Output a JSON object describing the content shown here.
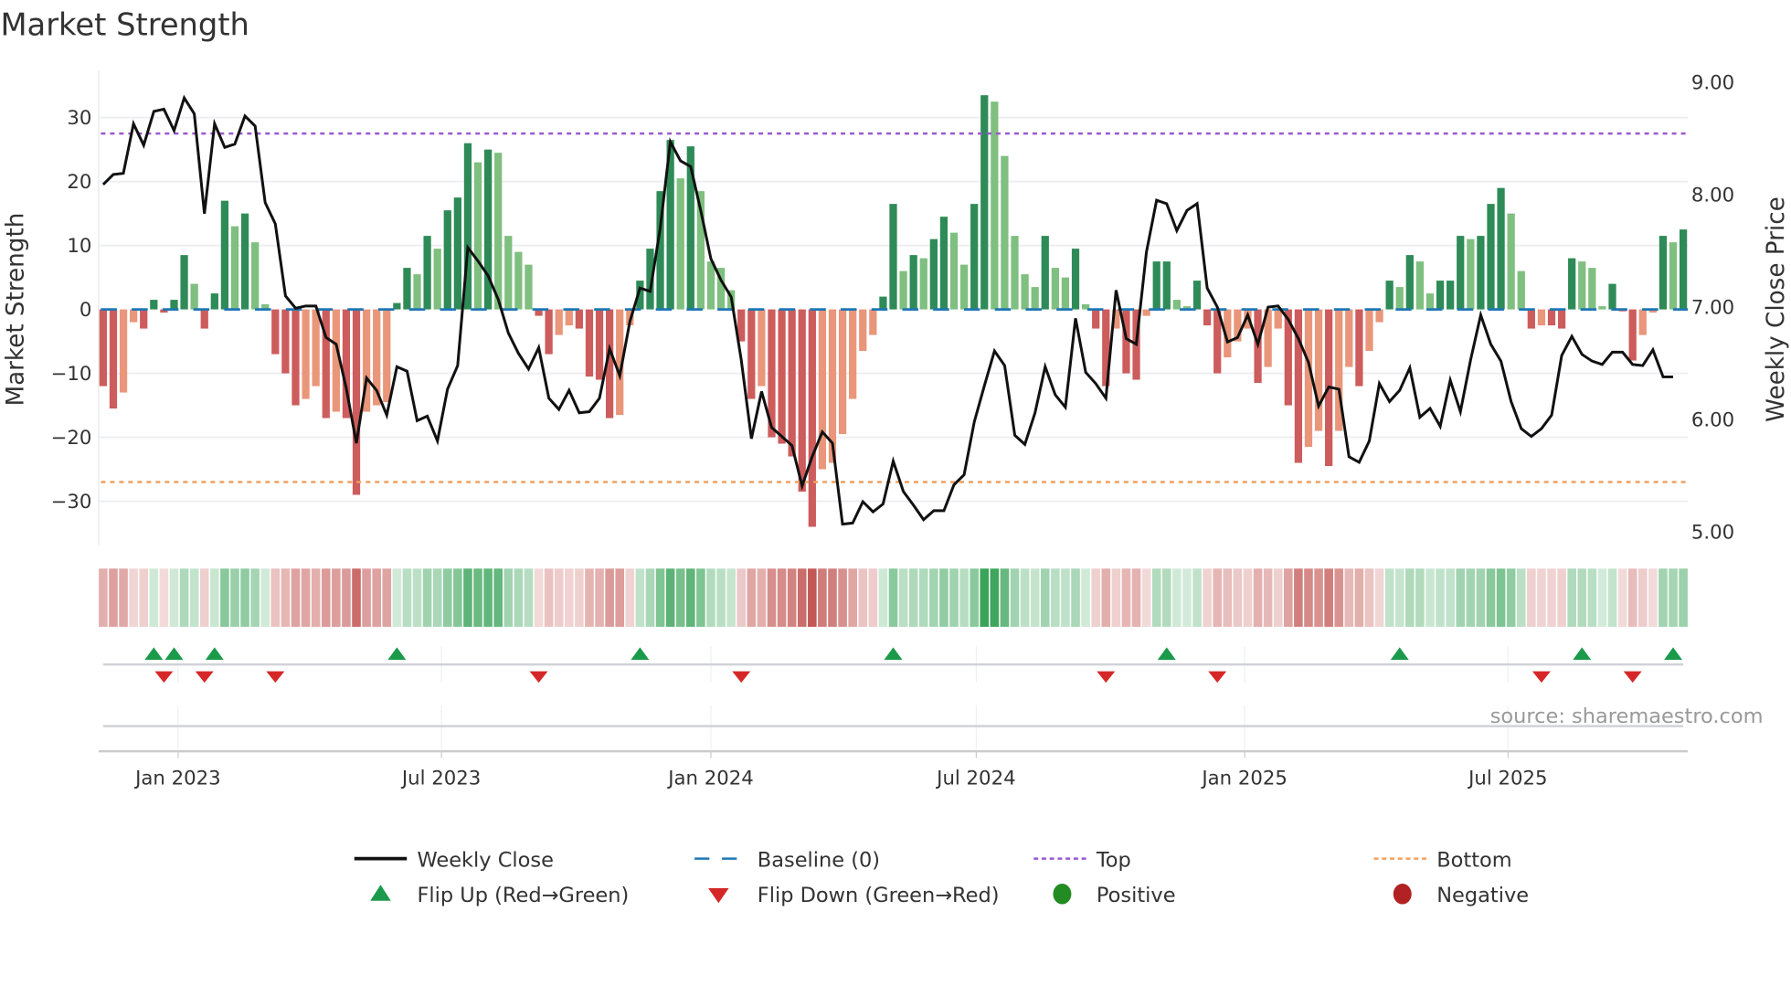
{
  "chart_data": {
    "type": "bar",
    "title": "Market Strength",
    "ylabel": "Market Strength",
    "ylabel_right": "Weekly Close Price",
    "ylim": [
      -35,
      37
    ],
    "ylim_right": [
      5.0,
      9.0
    ],
    "yticks": [
      "30",
      "20",
      "10",
      "0",
      "−10",
      "−20",
      "−30"
    ],
    "yticks_values": [
      30,
      20,
      10,
      0,
      -10,
      -20,
      -30
    ],
    "yticks_right": [
      "9.00",
      "8.00",
      "7.00",
      "6.00",
      "5.00"
    ],
    "yticks_right_values": [
      9,
      8,
      7,
      6,
      5
    ],
    "xticks": [
      "Jan 2023",
      "Jul 2023",
      "Jan 2024",
      "Jul 2024",
      "Jan 2025",
      "Jul 2025"
    ],
    "xticks_week_index": [
      7.4,
      33.4,
      60,
      86.2,
      112.7,
      138.7
    ],
    "top_level": 27.5,
    "bottom_level": -27,
    "baseline": 0,
    "grid": true,
    "source": "source: sharemaestro.com",
    "strength": [
      -12,
      -15.5,
      -13,
      -2,
      -3,
      1.5,
      -0.5,
      1.5,
      8.5,
      4,
      -3,
      2.5,
      17,
      13,
      15,
      10.5,
      0.8,
      -7,
      -10,
      -15,
      -14,
      -12,
      -17,
      -16,
      -17,
      -29,
      -16,
      -15,
      -14.5,
      1,
      6.5,
      5.5,
      11.5,
      9.5,
      15.5,
      17.5,
      26,
      23,
      25,
      24.5,
      11.5,
      9,
      7,
      -1,
      -7,
      -4,
      -2.5,
      -3,
      -10.5,
      -11,
      -17,
      -16.5,
      -2.5,
      4.5,
      9.5,
      18.5,
      26.5,
      20.5,
      25.5,
      18.5,
      7.5,
      6.5,
      3,
      -5,
      -14,
      -12,
      -20,
      -21,
      -23,
      -28.5,
      -34,
      -25,
      -24,
      -19.5,
      -14,
      -6.5,
      -4,
      2,
      16.5,
      6,
      8.5,
      8,
      11,
      14.5,
      12,
      7,
      16.5,
      33.5,
      32.5,
      24,
      11.5,
      5.5,
      3.5,
      11.5,
      6.5,
      5,
      9.5,
      0.8,
      -3,
      -12,
      -3,
      -10,
      -11,
      -1,
      7.5,
      7.5,
      1.5,
      0.5,
      4.5,
      -2.5,
      -10,
      -7.5,
      -5,
      -3,
      -11.5,
      -9,
      -3,
      -15,
      -24,
      -21.5,
      -19,
      -24.5,
      -19,
      -9,
      -12,
      -6.5,
      -2,
      4.5,
      3.5,
      8.5,
      7.5,
      2.5,
      4.5,
      4.5,
      11.5,
      11,
      11.5,
      16.5,
      19,
      15,
      6,
      -3,
      -2.5,
      -2.5,
      -3,
      8,
      7.5,
      6.5,
      0.5,
      4,
      -0.3,
      -8,
      -4,
      -0.5,
      11.5,
      10.5,
      12.5
    ],
    "weekly_close": [
      8.09,
      8.18,
      8.19,
      8.63,
      8.44,
      8.74,
      8.76,
      8.57,
      8.86,
      8.72,
      7.83,
      8.63,
      8.42,
      8.45,
      8.7,
      8.61,
      7.93,
      7.74,
      7.1,
      6.99,
      7.01,
      7.01,
      6.73,
      6.67,
      6.28,
      5.79,
      6.37,
      6.26,
      6.04,
      6.47,
      6.43,
      5.99,
      6.03,
      5.81,
      6.27,
      6.48,
      7.53,
      7.41,
      7.28,
      7.07,
      6.77,
      6.59,
      6.45,
      6.64,
      6.19,
      6.09,
      6.26,
      6.06,
      6.07,
      6.19,
      6.63,
      6.39,
      6.87,
      7.17,
      7.14,
      7.7,
      8.47,
      8.3,
      8.25,
      7.86,
      7.43,
      7.24,
      7.09,
      6.53,
      5.83,
      6.25,
      5.93,
      5.85,
      5.77,
      5.41,
      5.67,
      5.89,
      5.79,
      5.07,
      5.08,
      5.27,
      5.18,
      5.25,
      5.63,
      5.36,
      5.24,
      5.11,
      5.19,
      5.19,
      5.42,
      5.51,
      5.98,
      6.3,
      6.61,
      6.48,
      5.86,
      5.78,
      6.06,
      6.47,
      6.22,
      6.11,
      6.9,
      6.42,
      6.32,
      6.19,
      7.15,
      6.72,
      6.67,
      7.49,
      7.95,
      7.92,
      7.68,
      7.86,
      7.92,
      7.17,
      7.0,
      6.69,
      6.73,
      6.93,
      6.67,
      7.0,
      7.01,
      6.89,
      6.72,
      6.51,
      6.12,
      6.29,
      6.27,
      5.67,
      5.62,
      5.81,
      6.32,
      6.16,
      6.26,
      6.46,
      6.02,
      6.1,
      5.94,
      6.35,
      6.07,
      6.53,
      6.93,
      6.67,
      6.52,
      6.16,
      5.92,
      5.85,
      5.92,
      6.04,
      6.57,
      6.74,
      6.58,
      6.52,
      6.49,
      6.6,
      6.6,
      6.49,
      6.48,
      6.62,
      6.38,
      6.38
    ],
    "flip_up_week_index": [
      5,
      7,
      11,
      29,
      53,
      78,
      105,
      128,
      146,
      155
    ],
    "flip_down_week_index": [
      6,
      10,
      17,
      43,
      63,
      99,
      110,
      142,
      151
    ],
    "legend": {
      "placement": "bottom",
      "items": [
        {
          "label": "Weekly Close",
          "kind": "line",
          "color": "#111111"
        },
        {
          "label": "Baseline (0)",
          "kind": "dash",
          "color": "#1f77b4"
        },
        {
          "label": "Top",
          "kind": "dot",
          "color": "#9b59d0"
        },
        {
          "label": "Bottom",
          "kind": "dot",
          "color": "#f0a060"
        },
        {
          "label": "Flip Up (Red→Green)",
          "kind": "up",
          "color": "#1a9a4a"
        },
        {
          "label": "Flip Down (Green→Red)",
          "kind": "down",
          "color": "#d62728"
        },
        {
          "label": "Positive",
          "kind": "circle",
          "color": "#228b22"
        },
        {
          "label": "Negative",
          "kind": "circle",
          "color": "#b22222"
        }
      ]
    },
    "colors": {
      "pos_strong": "#2e8b57",
      "pos_weak": "#7fbf7f",
      "neg_strong": "#cd5c5c",
      "neg_weak": "#e9967a",
      "heat_pos": "#2e9e4f",
      "heat_neg": "#c0504d"
    }
  }
}
